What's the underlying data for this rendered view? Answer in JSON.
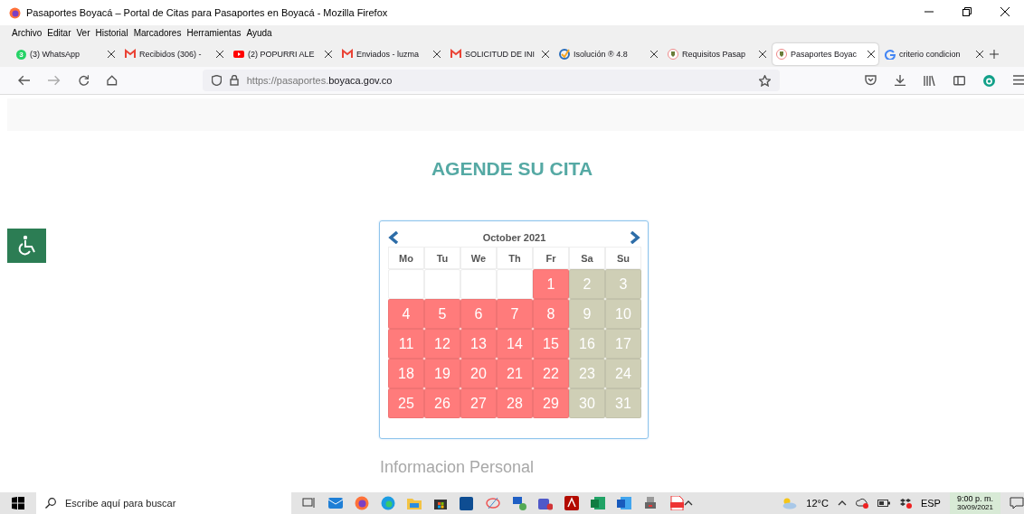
{
  "window": {
    "title": "Pasaportes Boyacá – Portal de Citas para Pasaportes en Boyacá - Mozilla Firefox"
  },
  "menu": [
    "Archivo",
    "Editar",
    "Ver",
    "Historial",
    "Marcadores",
    "Herramientas",
    "Ayuda"
  ],
  "tabs": [
    {
      "label": "(3) WhatsApp",
      "kind": "whatsapp",
      "badge": "3",
      "selected": false
    },
    {
      "label": "Recibidos (306) -",
      "kind": "mail",
      "selected": false
    },
    {
      "label": "(2) POPURRI ALE",
      "kind": "video",
      "selected": false
    },
    {
      "label": "Enviados - luzma",
      "kind": "mail",
      "selected": false
    },
    {
      "label": "SOLICITUD DE INI",
      "kind": "mail",
      "selected": false
    },
    {
      "label": "Isolución ® 4.8",
      "kind": "check",
      "selected": false
    },
    {
      "label": "Requisitos Pasap",
      "kind": "crest",
      "selected": false
    },
    {
      "label": "Pasaportes Boyac",
      "kind": "crest",
      "selected": true
    },
    {
      "label": "criterio condicion",
      "kind": "g",
      "selected": false
    }
  ],
  "address": {
    "url_prefix": "https://pasaportes.",
    "url_domain": "boyaca.gov.co"
  },
  "page": {
    "heading": "AGENDE SU CITA",
    "calendar": {
      "month": "October 2021",
      "weekdays": [
        "Mo",
        "Tu",
        "We",
        "Th",
        "Fr",
        "Sa",
        "Su"
      ],
      "weeks": [
        [
          {
            "kind": "empty"
          },
          {
            "kind": "empty"
          },
          {
            "kind": "empty"
          },
          {
            "kind": "empty"
          },
          {
            "kind": "day",
            "day": "1",
            "color": "#ff7b7b"
          },
          {
            "kind": "day",
            "day": "2",
            "color": "#cfcfb6"
          },
          {
            "kind": "day",
            "day": "3",
            "color": "#cfcfb6"
          }
        ],
        [
          {
            "kind": "day",
            "day": "4",
            "color": "#ff7b7b"
          },
          {
            "kind": "day",
            "day": "5",
            "color": "#ff7b7b"
          },
          {
            "kind": "day",
            "day": "6",
            "color": "#ff7b7b"
          },
          {
            "kind": "day",
            "day": "7",
            "color": "#ff7b7b"
          },
          {
            "kind": "day",
            "day": "8",
            "color": "#ff7b7b"
          },
          {
            "kind": "day",
            "day": "9",
            "color": "#cfcfb6"
          },
          {
            "kind": "day",
            "day": "10",
            "color": "#cfcfb6"
          }
        ],
        [
          {
            "kind": "day",
            "day": "11",
            "color": "#ff7b7b"
          },
          {
            "kind": "day",
            "day": "12",
            "color": "#ff7b7b"
          },
          {
            "kind": "day",
            "day": "13",
            "color": "#ff7b7b"
          },
          {
            "kind": "day",
            "day": "14",
            "color": "#ff7b7b"
          },
          {
            "kind": "day",
            "day": "15",
            "color": "#ff7b7b"
          },
          {
            "kind": "day",
            "day": "16",
            "color": "#cfcfb6"
          },
          {
            "kind": "day",
            "day": "17",
            "color": "#cfcfb6"
          }
        ],
        [
          {
            "kind": "day",
            "day": "18",
            "color": "#ff7b7b"
          },
          {
            "kind": "day",
            "day": "19",
            "color": "#ff7b7b"
          },
          {
            "kind": "day",
            "day": "20",
            "color": "#ff7b7b"
          },
          {
            "kind": "day",
            "day": "21",
            "color": "#ff7b7b"
          },
          {
            "kind": "day",
            "day": "22",
            "color": "#ff7b7b"
          },
          {
            "kind": "day",
            "day": "23",
            "color": "#cfcfb6"
          },
          {
            "kind": "day",
            "day": "24",
            "color": "#cfcfb6"
          }
        ],
        [
          {
            "kind": "day",
            "day": "25",
            "color": "#ff7b7b"
          },
          {
            "kind": "day",
            "day": "26",
            "color": "#ff7b7b"
          },
          {
            "kind": "day",
            "day": "27",
            "color": "#ff7b7b"
          },
          {
            "kind": "day",
            "day": "28",
            "color": "#ff7b7b"
          },
          {
            "kind": "day",
            "day": "29",
            "color": "#ff7b7b"
          },
          {
            "kind": "day",
            "day": "30",
            "color": "#cfcfb6"
          },
          {
            "kind": "day",
            "day": "31",
            "color": "#cfcfb6"
          }
        ]
      ]
    },
    "section_title": "Informacion Personal"
  },
  "taskbar": {
    "search_placeholder": "Escribe aquí para buscar",
    "temperature": "12°C",
    "language": "ESP",
    "time": "9:00 p. m.",
    "date": "30/09/2021"
  }
}
